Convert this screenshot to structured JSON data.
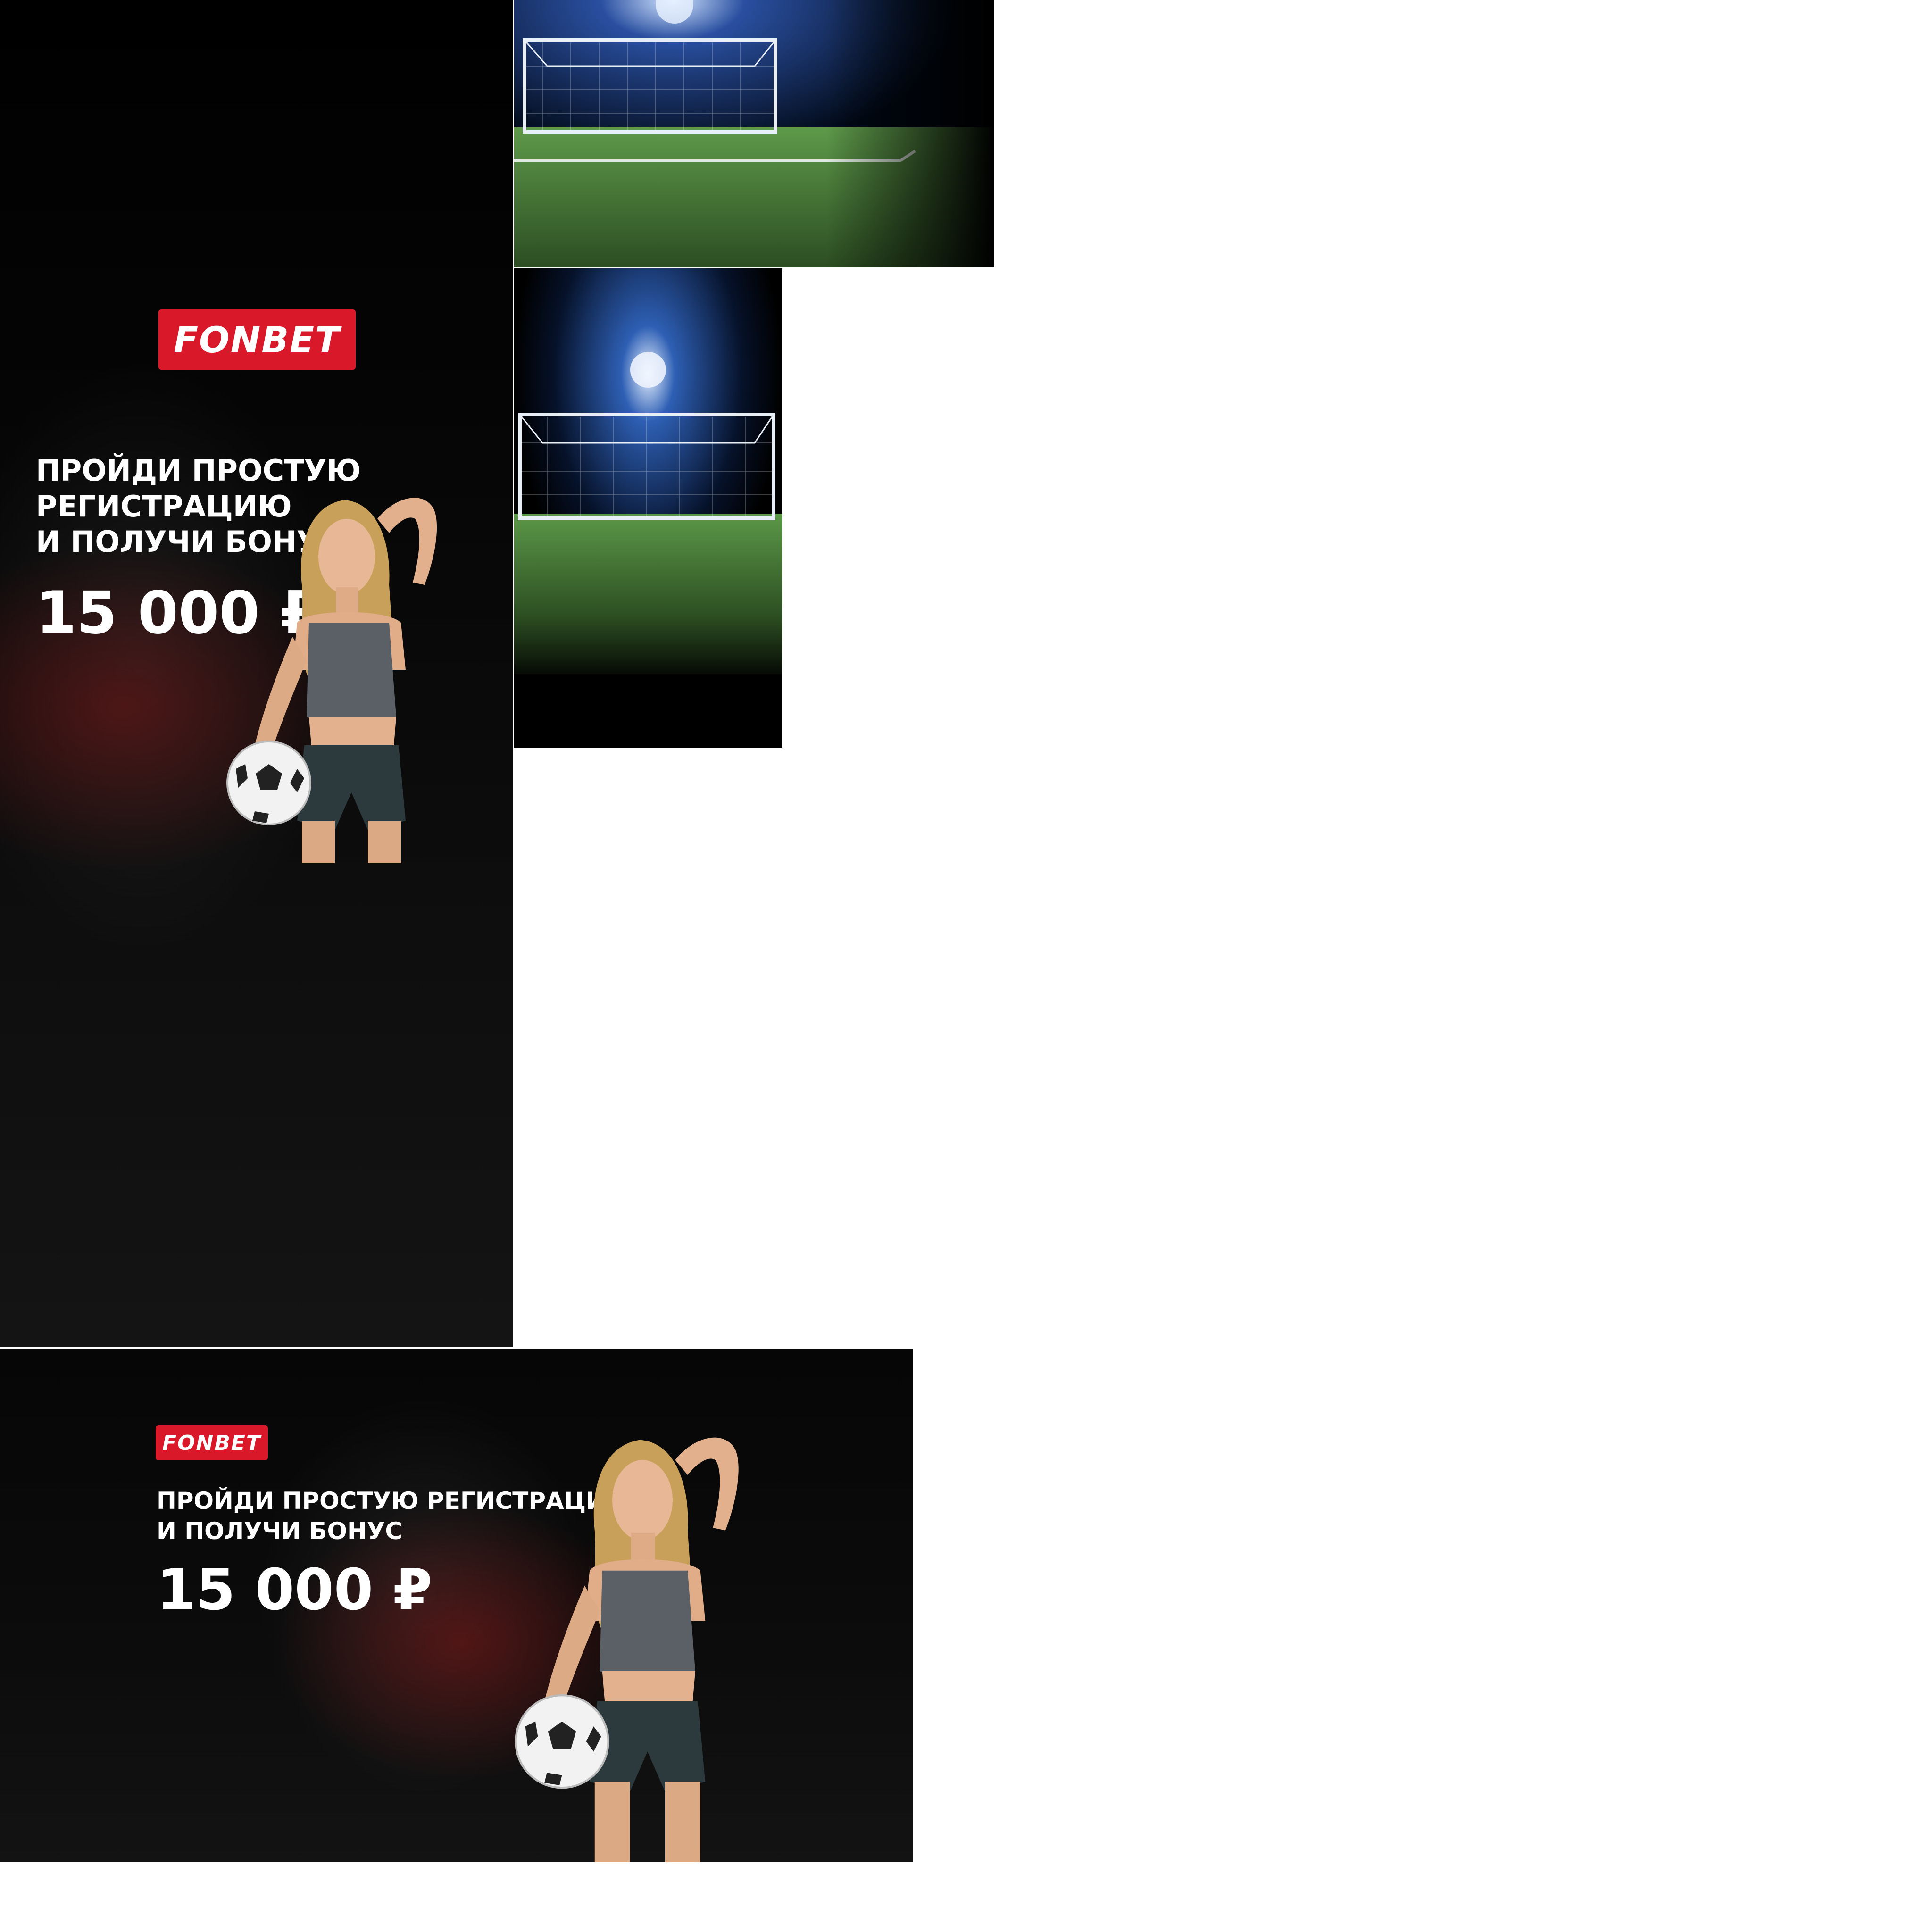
{
  "vertical_banner": {
    "logo_text": "FONBET",
    "headline_lines": [
      "ПРОЙДИ ПРОСТУЮ",
      "РЕГИСТРАЦИЮ",
      "И ПОЛУЧИ БОНУС"
    ],
    "amount": "15 000 ₽"
  },
  "horizontal_banner": {
    "logo_text": "FONBET",
    "headline_lines": [
      "ПРОЙДИ ПРОСТУЮ РЕГИСТРАЦИЮ",
      "И ПОЛУЧИ БОНУС"
    ],
    "amount": "15 000 ₽"
  },
  "colors": {
    "brand_red": "#d9182a",
    "background": "#000000",
    "text": "#ffffff",
    "pitch_green": "#3f7a32"
  },
  "icons": [
    "soccer-ball-icon",
    "soccer-goal-icon",
    "stadium-floodlight-icon"
  ]
}
